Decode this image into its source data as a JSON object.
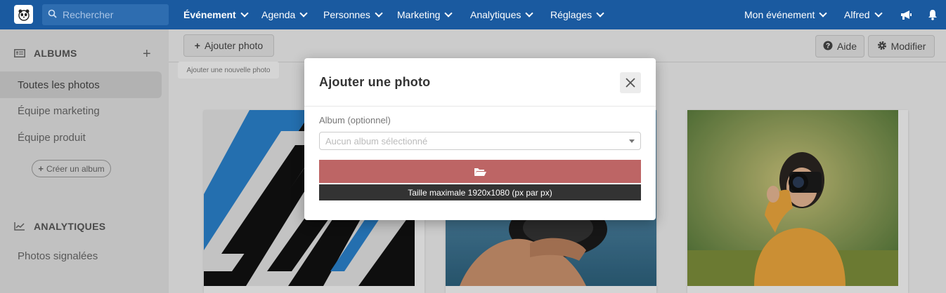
{
  "nav": {
    "search_placeholder": "Rechercher",
    "menus": [
      "Événement",
      "Agenda",
      "Personnes",
      "Marketing",
      "Analytiques",
      "Réglages"
    ],
    "event_menu": "Mon événement",
    "user_menu": "Alfred",
    "icons": [
      "megaphone-icon",
      "bell-icon"
    ]
  },
  "sidebar": {
    "albums_heading": "ALBUMS",
    "albums": [
      "Toutes les photos",
      "Équipe marketing",
      "Équipe produit"
    ],
    "create_album": "Créer un album",
    "analytics_heading": "ANALYTIQUES",
    "analytics_items": [
      "Photos signalées"
    ]
  },
  "toolbar": {
    "add_photo": "Ajouter photo",
    "add_photo_tooltip": "Ajouter une nouvelle photo",
    "help": "Aide",
    "edit": "Modifier"
  },
  "modal": {
    "title": "Ajouter une photo",
    "album_label": "Album (optionnel)",
    "album_placeholder": "Aucun album sélectionné",
    "max_size": "Taille maximale 1920x1080 (px par px)"
  },
  "colors": {
    "nav_bg": "#1a5aa0",
    "upload_button": "#bd6565"
  }
}
